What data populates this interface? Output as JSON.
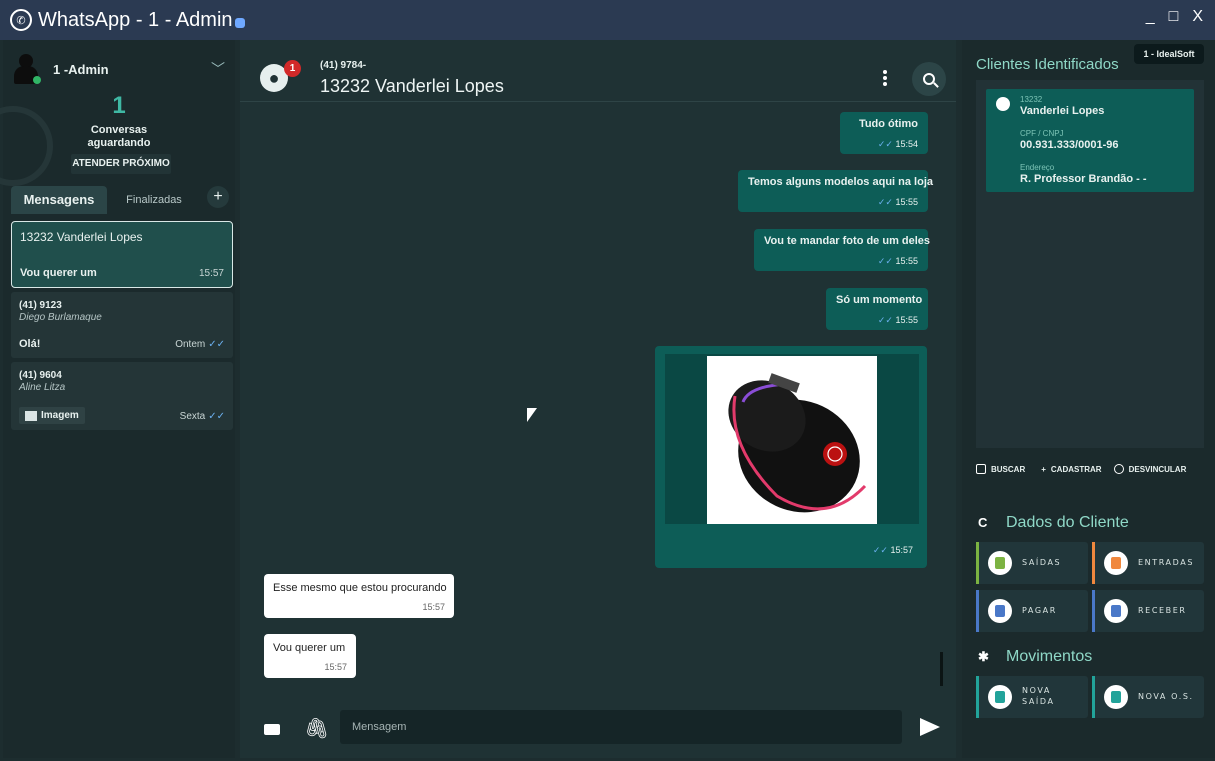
{
  "window": {
    "title": "WhatsApp - 1 - Admin",
    "controls": [
      "_",
      "□",
      "X"
    ]
  },
  "sidebar": {
    "user": "1 -Admin",
    "waiting_count": "1",
    "waiting_label_1": "Conversas",
    "waiting_label_2": "aguardando",
    "attend_button": "ATENDER PRÓXIMO",
    "tabs": [
      "Mensagens",
      "Finalizadas"
    ],
    "conversations": [
      {
        "title": "13232 Vanderlei Lopes",
        "subtitle": "",
        "last_message": "Vou querer um",
        "time": "15:57"
      },
      {
        "title": "(41) 9123",
        "subtitle": "Diego Burlamaque",
        "last_message": "Olá!",
        "time": "Ontem"
      },
      {
        "title": "(41) 9604",
        "subtitle": "Aline Litza",
        "last_message": "Imagem",
        "time": "Sexta"
      }
    ]
  },
  "chat": {
    "phone": "(41) 9784-",
    "name": "13232 Vanderlei Lopes",
    "unread_badge": "1",
    "messages": [
      {
        "dir": "out",
        "text": "Tudo ótimo",
        "time": "15:54"
      },
      {
        "dir": "out",
        "text": "Temos alguns modelos aqui na loja",
        "time": "15:55"
      },
      {
        "dir": "out",
        "text": "Vou te mandar foto de um deles",
        "time": "15:55"
      },
      {
        "dir": "out",
        "text": "Só um momento",
        "time": "15:55"
      },
      {
        "dir": "out",
        "text": "",
        "time": "15:57",
        "image": "gaming-mouse"
      },
      {
        "dir": "in",
        "text": "Esse mesmo que estou procurando",
        "time": "15:57"
      },
      {
        "dir": "in",
        "text": "Vou querer um",
        "time": "15:57"
      }
    ],
    "composer_placeholder": "Mensagem"
  },
  "right_panel": {
    "title": "Clientes Identificados",
    "tag": "1 - IdealSoft",
    "client": {
      "code": "13232",
      "name": "Vanderlei Lopes",
      "doc_label": "CPF / CNPJ",
      "doc_value": "00.931.333/0001-96",
      "address_label": "Endereço",
      "address_value": "R. Professor Brandão - -"
    },
    "actions": [
      "BUSCAR",
      "CADASTRAR",
      "DESVINCULAR"
    ],
    "dados_title": "Dados do Cliente",
    "dados_tiles": [
      {
        "label": "SAÍDAS",
        "color": "#7cb342"
      },
      {
        "label": "ENTRADAS",
        "color": "#f0883e"
      },
      {
        "label": "PAGAR",
        "color": "#4a78c8"
      },
      {
        "label": "RECEBER",
        "color": "#4a78c8"
      }
    ],
    "movimentos_title": "Movimentos",
    "mov_tiles": [
      {
        "label_1": "NOVA",
        "label_2": "SAÍDA",
        "color": "#22a39a"
      },
      {
        "label": "NOVA O.S.",
        "color": "#22a39a"
      }
    ]
  }
}
